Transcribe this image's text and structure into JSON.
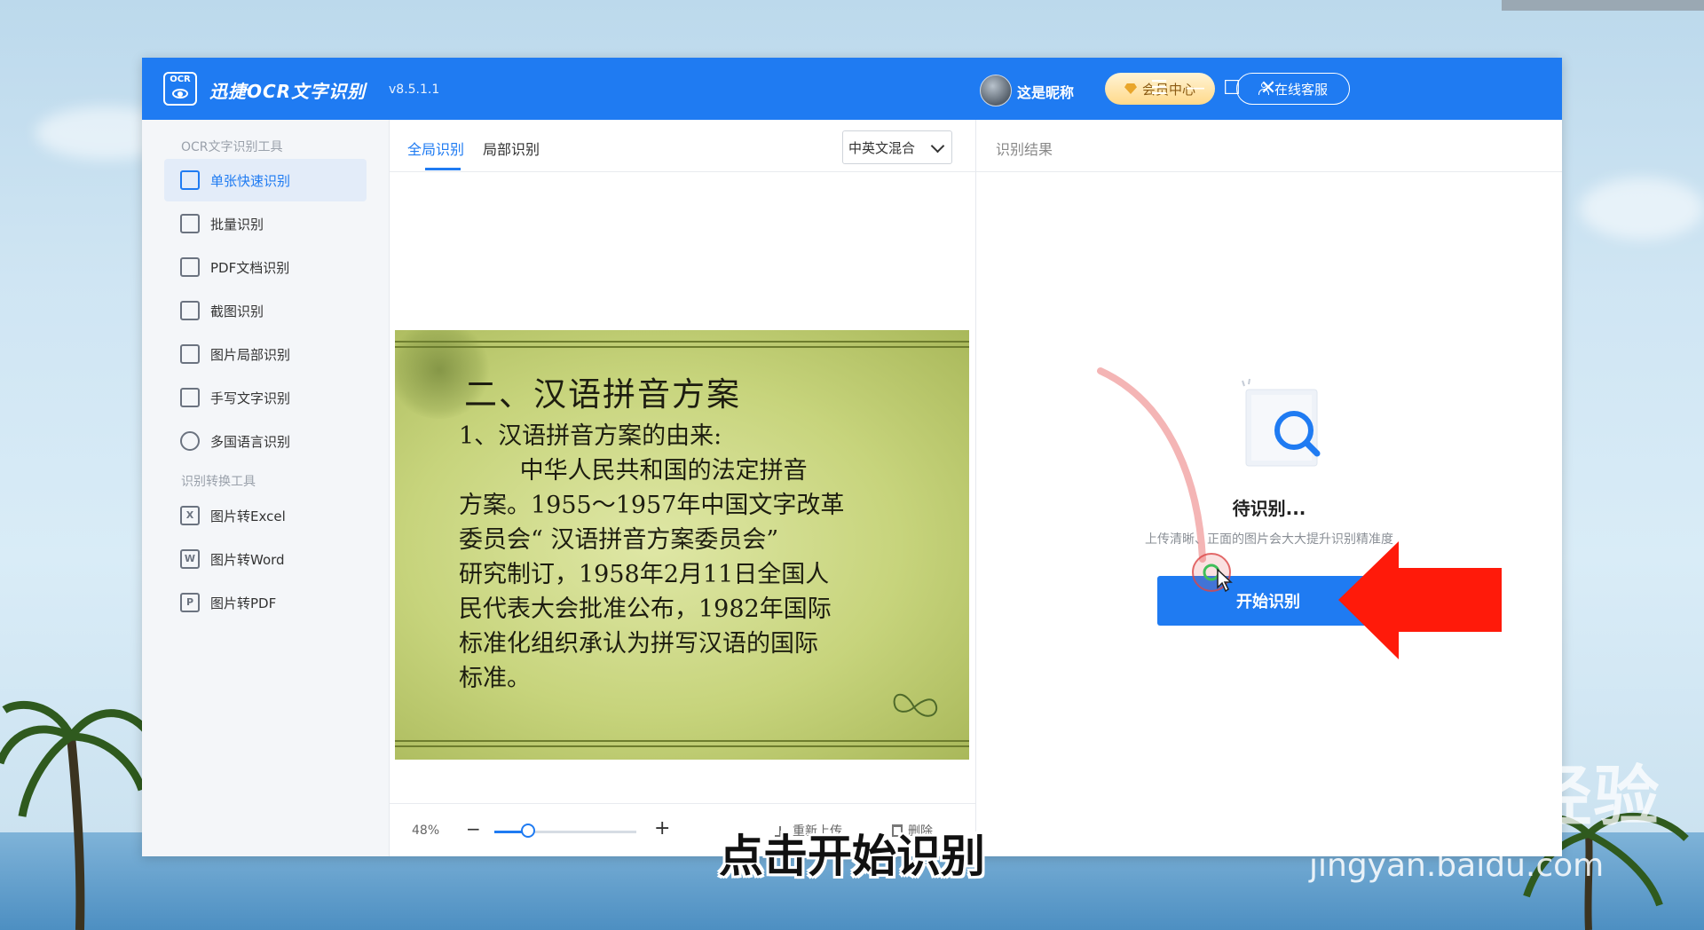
{
  "window": {
    "app_name": "迅捷OCR文字识别",
    "version": "v8.5.1.1",
    "logo_text": "OCR",
    "user_nickname": "这是昵称",
    "vip_label": "会员中心",
    "service_label": "在线客服",
    "controls": [
      "menu-icon",
      "minimize-icon",
      "maximize-icon",
      "close-icon"
    ]
  },
  "sidebar": {
    "group1": "OCR文字识别工具",
    "items": [
      {
        "label": "单张快速识别",
        "icon": "single-scan-icon",
        "active": true
      },
      {
        "label": "批量识别",
        "icon": "batch-icon"
      },
      {
        "label": "PDF文档识别",
        "icon": "pdf-icon"
      },
      {
        "label": "截图识别",
        "icon": "crop-icon"
      },
      {
        "label": "图片局部识别",
        "icon": "partial-image-icon"
      },
      {
        "label": "手写文字识别",
        "icon": "pen-icon"
      },
      {
        "label": "多国语言识别",
        "icon": "globe-icon"
      }
    ],
    "group2": "识别转换工具",
    "convert_items": [
      {
        "label": "图片转Excel",
        "icon_letter": "X"
      },
      {
        "label": "图片转Word",
        "icon_letter": "W"
      },
      {
        "label": "图片转PDF",
        "icon_letter": "P"
      }
    ]
  },
  "middle": {
    "tabs": [
      "全局识别",
      "局部识别"
    ],
    "active_tab": 0,
    "language": "中英文混合",
    "slide": {
      "title": "二、汉语拼音方案",
      "body": "1、汉语拼音方案的由来:\n        中华人民共和国的法定拼音\n方案。1955～1957年中国文字改革\n委员会“ 汉语拼音方案委员会”\n研究制订，1958年2月11日全国人\n民代表大会批准公布，1982年国际\n标准化组织承认为拼写汉语的国际\n标准。"
    },
    "zoom": {
      "label": "48%",
      "fraction": 0.24
    },
    "reupload_label": "重新上传",
    "delete_label": "删除"
  },
  "right": {
    "title": "识别结果",
    "pending_title": "待识别...",
    "pending_hint": "上传清晰、正面的图片会大大提升识别精准度",
    "start_button": "开始识别"
  },
  "overlay": {
    "subtitle": "点击开始识别",
    "watermark_logo": "Baidu经验",
    "watermark_url": "jingyan.baidu.com"
  },
  "colors": {
    "accent": "#1f7bf2",
    "arrow": "#ff1a0a"
  }
}
